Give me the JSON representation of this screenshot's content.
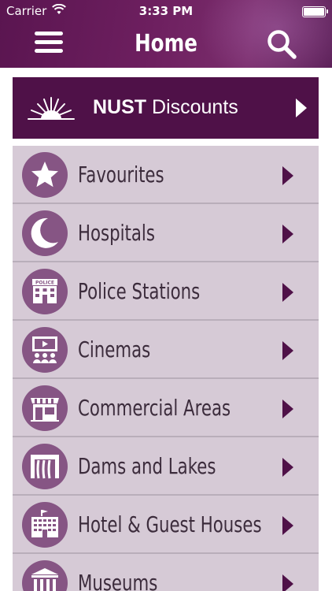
{
  "status_bar": {
    "carrier": "Carrier",
    "time": "3:33 PM"
  },
  "header": {
    "title": "Home",
    "menu_icon": "hamburger-icon",
    "search_icon": "search-icon"
  },
  "banner": {
    "brand": "NUST",
    "label": "Discounts",
    "icon": "nust-logo-icon"
  },
  "list": {
    "items": [
      {
        "label": "Favourites",
        "icon": "star-icon"
      },
      {
        "label": "Hospitals",
        "icon": "crescent-icon"
      },
      {
        "label": "Police Stations",
        "icon": "police-station-icon",
        "icon_text": "POLICE"
      },
      {
        "label": "Cinemas",
        "icon": "cinema-icon"
      },
      {
        "label": "Commercial Areas",
        "icon": "shop-icon"
      },
      {
        "label": "Dams and Lakes",
        "icon": "dam-icon"
      },
      {
        "label": "Hotel & Guest Houses",
        "icon": "hotel-icon"
      },
      {
        "label": "Museums",
        "icon": "museum-icon"
      }
    ]
  },
  "colors": {
    "header_bg": "#6d1f5f",
    "banner_bg": "#4f1148",
    "list_bg": "#d6cad6",
    "icon_circle": "#865584",
    "row_text": "#3c2c3c",
    "chevron": "#4f1148"
  }
}
